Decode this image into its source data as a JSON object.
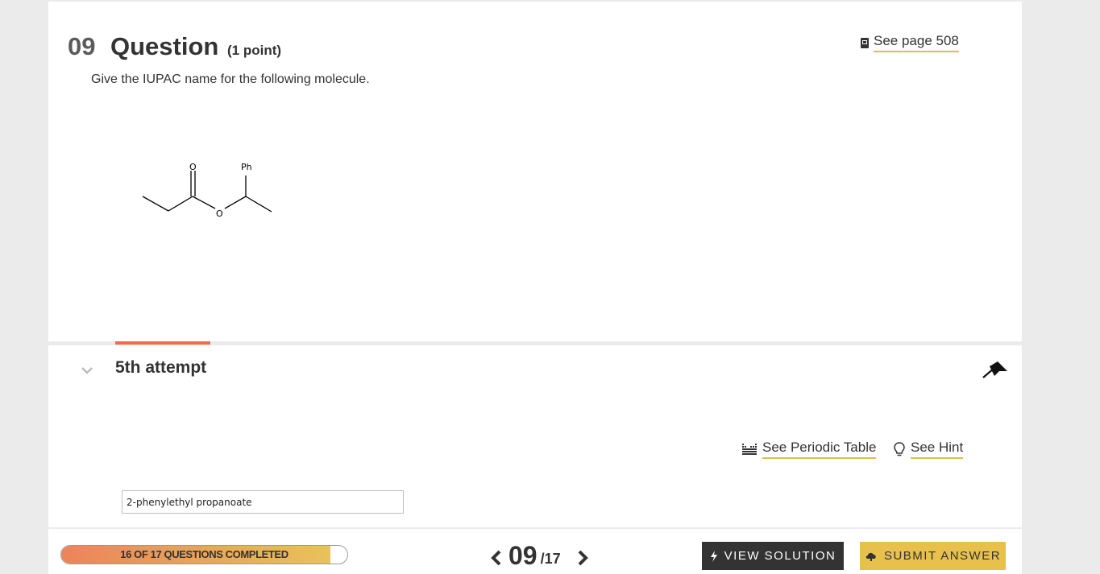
{
  "question": {
    "number": "09",
    "title": "Question",
    "points": "(1 point)",
    "text": "Give the IUPAC name for the following molecule.",
    "see_page_label": "See page 508",
    "molecule_labels": {
      "carbonyl_o": "O",
      "ester_o": "O",
      "substituent": "Ph"
    }
  },
  "attempt": {
    "label": "5th attempt",
    "periodic_table_label": "See Periodic Table",
    "hint_label": "See Hint",
    "answer_value": "2-phenylethyl propanoate"
  },
  "footer": {
    "progress_label": "16 OF 17 QUESTIONS COMPLETED",
    "progress_fraction": 0.941,
    "current_page": "09",
    "total_pages": "/17",
    "view_solution_label": "VIEW SOLUTION",
    "submit_label": "SUBMIT ANSWER"
  },
  "colors": {
    "accent_yellow": "#e8c14c",
    "accent_orange": "#ec6c4c",
    "dark_button": "#333333"
  }
}
